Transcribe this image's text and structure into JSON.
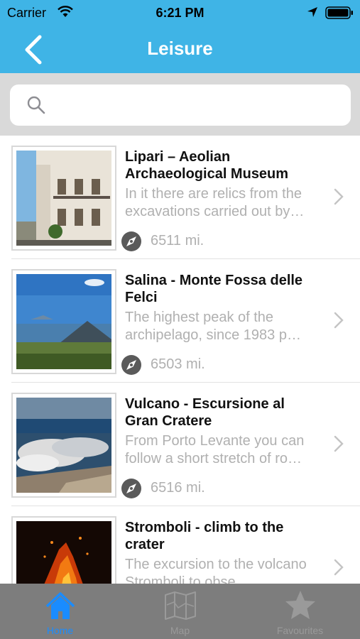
{
  "status_bar": {
    "carrier": "Carrier",
    "time": "6:21 PM"
  },
  "header": {
    "title": "Leisure"
  },
  "search": {
    "placeholder": "",
    "value": ""
  },
  "items": [
    {
      "title": "Lipari – Aeolian Archaeological Museum",
      "description": "In it there are relics from the excavations carried out by…",
      "distance": "6511 mi."
    },
    {
      "title": "Salina - Monte Fossa delle Felci",
      "description": "The highest peak of the archipelago, since 1983 p…",
      "distance": "6503 mi."
    },
    {
      "title": "Vulcano - Escursione al Gran Cratere",
      "description": "From Porto Levante you can follow a short stretch of ro…",
      "distance": "6516 mi."
    },
    {
      "title": "Stromboli - climb to the crater",
      "description": "The excursion to the volcano Stromboli to obse…",
      "distance": ""
    }
  ],
  "tabs": [
    {
      "label": "Home",
      "icon": "home-icon",
      "active": true
    },
    {
      "label": "Map",
      "icon": "map-icon",
      "active": false
    },
    {
      "label": "Favourites",
      "icon": "star-icon",
      "active": false
    }
  ],
  "colors": {
    "header": "#3fb4e6",
    "active_tab": "#1a8cff",
    "tabbar": "#7d7d7d"
  }
}
